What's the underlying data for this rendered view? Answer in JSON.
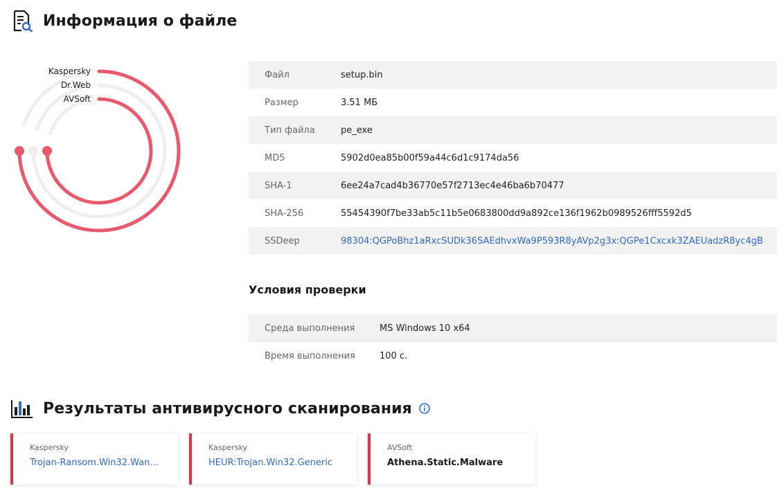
{
  "file_info": {
    "title": "Информация о файле",
    "rows": [
      {
        "key": "Файл",
        "value": "setup.bin"
      },
      {
        "key": "Размер",
        "value": "3.51 МБ"
      },
      {
        "key": "Тип файла",
        "value": "pe_exe"
      },
      {
        "key": "MD5",
        "value": "5902d0ea85b00f59a44c6d1c9174da56"
      },
      {
        "key": "SHA-1",
        "value": "6ee24a7cad4b36770e57f2713ec4e46ba6b70477"
      },
      {
        "key": "SHA-256",
        "value": "55454390f7be33ab5c11b5e0683800dd9a892ce136f1962b0989526fff5592d5"
      },
      {
        "key": "SSDeep",
        "value": "98304:QGPoBhz1aRxcSUDk36SAEdhvxWa9P593R8yAVp2g3x:QGPe1Cxcxk3ZAEUadzR8yc4gB"
      }
    ]
  },
  "conditions": {
    "title": "Условия проверки",
    "rows": [
      {
        "key": "Среда выполнения",
        "value": "MS Windows 10 x64"
      },
      {
        "key": "Время выполнения",
        "value": "100 с."
      }
    ]
  },
  "engines_chart": {
    "rings": [
      {
        "label": "Kaspersky",
        "detected": true
      },
      {
        "label": "Dr.Web",
        "detected": false
      },
      {
        "label": "AVSoft",
        "detected": true
      }
    ],
    "colors": {
      "detected": "#e8596e",
      "clean": "#eeeeee"
    }
  },
  "av_results": {
    "title": "Результаты антивирусного сканирования",
    "cards": [
      {
        "engine": "Kaspersky",
        "verdict": "Trojan-Ransom.Win32.Wan..."
      },
      {
        "engine": "Kaspersky",
        "verdict": "HEUR:Trojan.Win32.Generic"
      },
      {
        "engine": "AVSoft",
        "verdict": "Athena.Static.Malware"
      }
    ]
  },
  "colors": {
    "accent_red": "#e0334a",
    "link_blue": "#2f6ac7",
    "stripe": "#f2f2f2"
  },
  "icons": {
    "file_info": "file-search-icon",
    "results": "bar-chart-icon",
    "info": "info-circle-icon"
  }
}
